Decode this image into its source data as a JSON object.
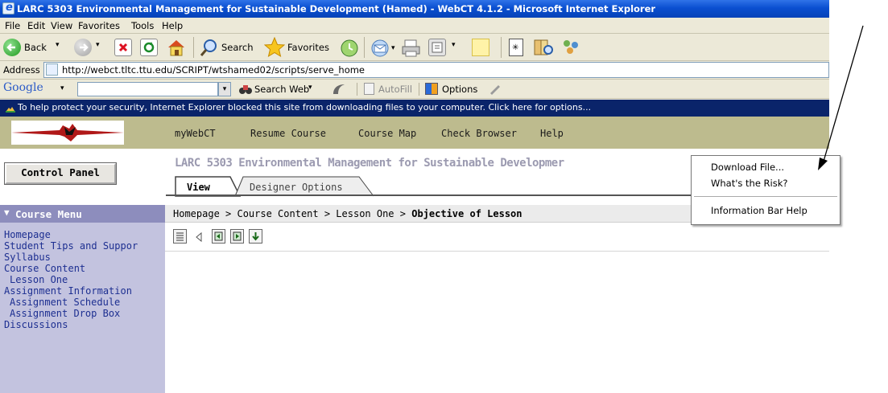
{
  "window": {
    "title": "LARC 5303 Environmental Management for Sustainable Development (Hamed) - WebCT 4.1.2 - Microsoft Internet Explorer"
  },
  "menu": [
    "File",
    "Edit",
    "View",
    "Favorites",
    "Tools",
    "Help"
  ],
  "toolbar": {
    "back": "Back",
    "search": "Search",
    "favorites": "Favorites"
  },
  "address": {
    "label": "Address",
    "url": "http://webct.tltc.ttu.edu/SCRIPT/wtshamed02/scripts/serve_home"
  },
  "google_toolbar": {
    "logo": "Google",
    "search_web": "Search Web",
    "autofill": "AutoFill",
    "options": "Options"
  },
  "infobar": {
    "message": "To help protect your security, Internet Explorer blocked this site from downloading files to your computer. Click here for options..."
  },
  "webct_nav": [
    "myWebCT",
    "Resume Course",
    "Course Map",
    "Check Browser",
    "Help"
  ],
  "control_panel": "Control Panel",
  "course_title": "LARC 5303 Environmental Management for Sustainable Developmer",
  "tabs": [
    "View",
    "Designer Options"
  ],
  "course_menu": {
    "heading": "Course Menu",
    "items": [
      "Homepage",
      "Student Tips and Suppor",
      "Syllabus",
      "Course Content",
      "Lesson One",
      "Assignment Information",
      "Assignment Schedule",
      "Assignment Drop Box",
      "Discussions"
    ]
  },
  "breadcrumb": {
    "path": "Homepage > Course Content > Lesson One > ",
    "current": "Objective of Lesson"
  },
  "popup_menu": {
    "items": [
      "Download File...",
      "What's the Risk?",
      "Information Bar Help"
    ]
  },
  "colors": {
    "titlebar": "#0a4fd0",
    "infobar": "#0a246a",
    "webct_bar": "#bdbb8e",
    "course_menu": "#c3c3df",
    "course_menu_head": "#8d8dbd"
  }
}
